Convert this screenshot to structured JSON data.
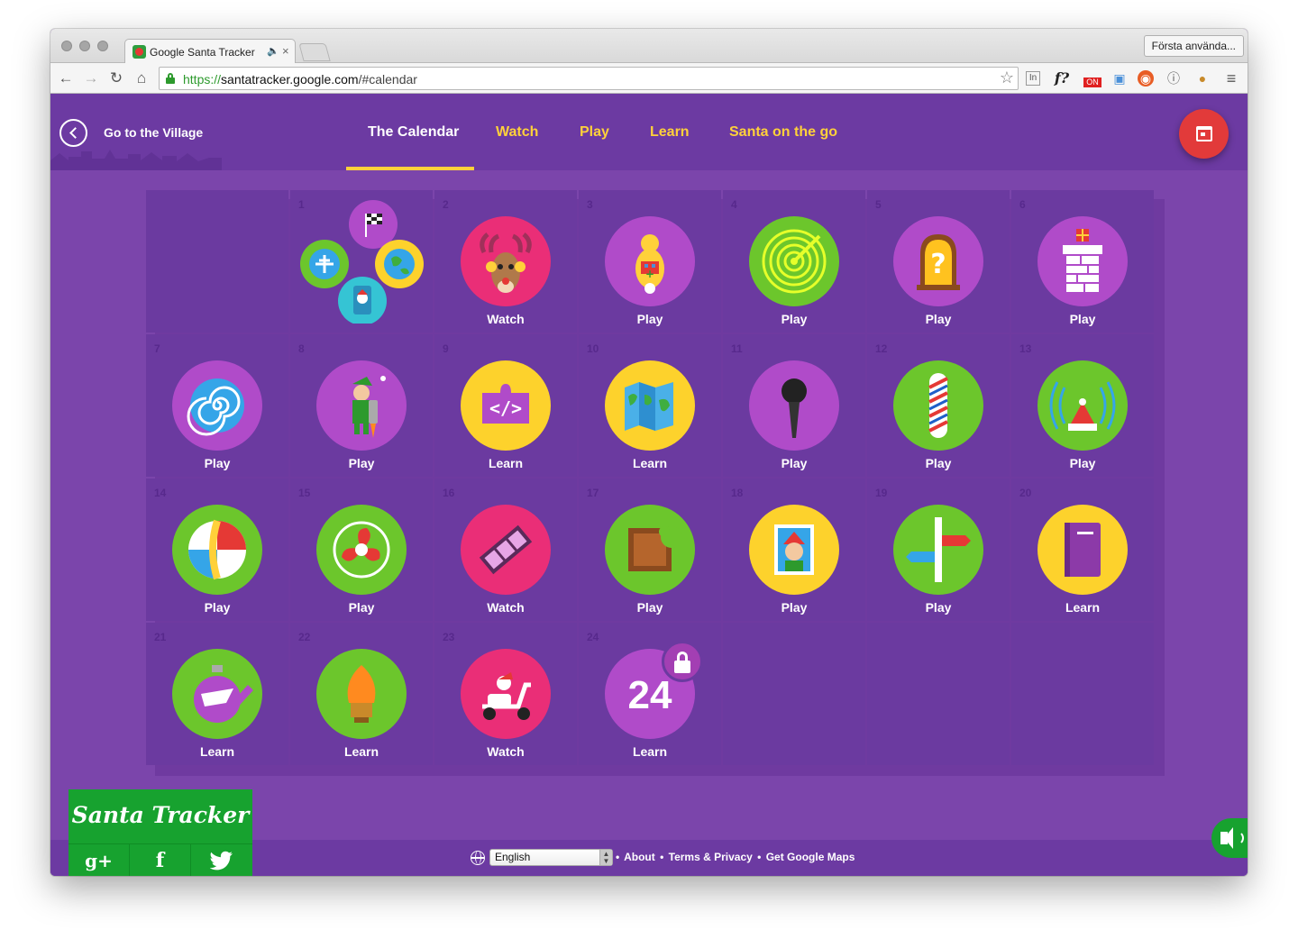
{
  "browser": {
    "tab_title": "Google Santa Tracker",
    "tab_audio_icon": "speaker-icon",
    "tab_close": "×",
    "profile_button": "Första använda...",
    "url_scheme": "https://",
    "url_host": "santatracker.google.com",
    "url_path": "/#calendar"
  },
  "header": {
    "back_label": "Go to the Village",
    "nav": [
      "The Calendar",
      "Watch",
      "Play",
      "Learn",
      "Santa on the go"
    ],
    "active_nav": "The Calendar"
  },
  "calendar": {
    "days": [
      {
        "day": "",
        "label": "",
        "bg": "",
        "icon": "empty-icon"
      },
      {
        "day": "1",
        "label": "",
        "bg": "#7b45ab",
        "icon": "santa-app-cluster-icon"
      },
      {
        "day": "2",
        "label": "Watch",
        "bg": "#ea2e77",
        "icon": "reindeer-icon"
      },
      {
        "day": "3",
        "label": "Play",
        "bg": "#b04bc9",
        "icon": "elf-robot-icon"
      },
      {
        "day": "4",
        "label": "Play",
        "bg": "#6cc62c",
        "icon": "target-icon"
      },
      {
        "day": "5",
        "label": "Play",
        "bg": "#b04bc9",
        "icon": "mystery-door-icon"
      },
      {
        "day": "6",
        "label": "Play",
        "bg": "#b04bc9",
        "icon": "chimney-present-icon"
      },
      {
        "day": "7",
        "label": "Play",
        "bg": "#b04bc9",
        "icon": "spiral-icon"
      },
      {
        "day": "8",
        "label": "Play",
        "bg": "#b04bc9",
        "icon": "jetpack-elf-icon"
      },
      {
        "day": "9",
        "label": "Learn",
        "bg": "#fdd22c",
        "icon": "code-puzzle-icon"
      },
      {
        "day": "10",
        "label": "Learn",
        "bg": "#fdd22c",
        "icon": "map-icon"
      },
      {
        "day": "11",
        "label": "Play",
        "bg": "#b04bc9",
        "icon": "microphone-icon"
      },
      {
        "day": "12",
        "label": "Play",
        "bg": "#6cc62c",
        "icon": "barber-pole-icon"
      },
      {
        "day": "13",
        "label": "Play",
        "bg": "#6cc62c",
        "icon": "radar-hat-icon"
      },
      {
        "day": "14",
        "label": "Play",
        "bg": "#6cc62c",
        "icon": "beach-ball-icon"
      },
      {
        "day": "15",
        "label": "Play",
        "bg": "#6cc62c",
        "icon": "fan-icon"
      },
      {
        "day": "16",
        "label": "Watch",
        "bg": "#ea2e77",
        "icon": "film-reel-icon"
      },
      {
        "day": "17",
        "label": "Play",
        "bg": "#6cc62c",
        "icon": "chocolate-icon"
      },
      {
        "day": "18",
        "label": "Play",
        "bg": "#fdd22c",
        "icon": "elf-stamp-icon"
      },
      {
        "day": "19",
        "label": "Play",
        "bg": "#6cc62c",
        "icon": "signpost-icon"
      },
      {
        "day": "20",
        "label": "Learn",
        "bg": "#fdd22c",
        "icon": "book-icon"
      },
      {
        "day": "21",
        "label": "Learn",
        "bg": "#6cc62c",
        "icon": "ornament-icon"
      },
      {
        "day": "22",
        "label": "Learn",
        "bg": "#6cc62c",
        "icon": "light-bulb-icon"
      },
      {
        "day": "23",
        "label": "Watch",
        "bg": "#ea2e77",
        "icon": "scooter-icon"
      },
      {
        "day": "24",
        "label": "Learn",
        "bg": "#b04bc9",
        "icon": "locked-24-icon",
        "big_number": "24"
      },
      {
        "day": "",
        "label": "",
        "bg": "",
        "icon": "empty-icon"
      },
      {
        "day": "",
        "label": "",
        "bg": "",
        "icon": "empty-icon"
      },
      {
        "day": "",
        "label": "",
        "bg": "",
        "icon": "empty-icon"
      }
    ]
  },
  "footer": {
    "language": "English",
    "links": [
      "About",
      "Terms & Privacy",
      "Get Google Maps"
    ],
    "separator": "•"
  },
  "brand": {
    "title": "Santa Tracker",
    "social": [
      "g+",
      "f",
      "twitter"
    ]
  },
  "colors": {
    "page_bg": "#7b45ab",
    "header_bg": "#6c3aa2",
    "cell_bg": "#6b3aa0",
    "accent_yellow": "#ffd13a",
    "fab_red": "#e23a3a",
    "brand_green": "#17a22f"
  }
}
